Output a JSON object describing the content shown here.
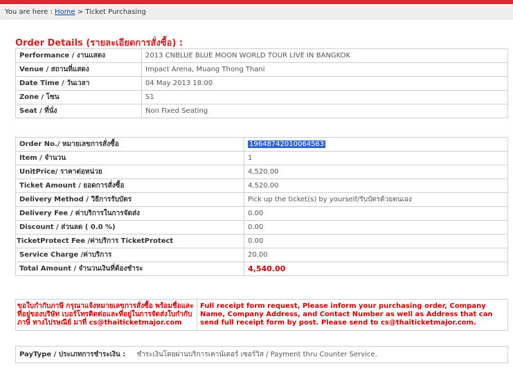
{
  "breadcrumb": {
    "prefix": "You are here :",
    "home": "Home",
    "separator": ">",
    "current": "Ticket Purchasing"
  },
  "order_details": {
    "title": "Order Details (รายละเอียดการสั่งซื้อ) :",
    "rows": [
      {
        "label": "Performance / งานแสดง",
        "value": "2013 CNBLUE BLUE MOON WORLD TOUR LIVE IN BANGKOK"
      },
      {
        "label": "Venue / สถานที่แสดง",
        "value": "Impact Arena, Muang Thong Thani"
      },
      {
        "label": "Date Time / วันเวลา",
        "value": "04 May 2013 18:00"
      },
      {
        "label": "Zone / โซน",
        "value": "S1"
      },
      {
        "label": "Seat / ที่นั่ง",
        "value": "Non Fixed Seating"
      }
    ]
  },
  "order_summary": {
    "rows": [
      {
        "label": "Order No./ หมายเลขการสั่งซื้อ",
        "value": "19648742010064563"
      },
      {
        "label": "Item / จำนวน",
        "value": "1"
      },
      {
        "label": "UnitPrice/ ราคาต่อหน่วย",
        "value": "4,520.00"
      },
      {
        "label": "Ticket Amount / ยอดการสั่งซื้อ",
        "value": "4,520.00"
      },
      {
        "label": "Delivery Method / วิธีการรับบัตร",
        "value": "Pick up the ticket(s) by yourself/รับบัตรด้วยตนเอง"
      },
      {
        "label": "Delivery Fee / ค่าบริการในการจัดส่ง",
        "value": "0.00"
      },
      {
        "label": "Discount / ส่วนลด ( 0.0 %)",
        "value": "0.00"
      },
      {
        "label": "TicketProtect Fee /ค่าบริการ TicketProtect",
        "value": "0.00"
      },
      {
        "label": "Service Charge /ค่าบริการ",
        "value": "20.00"
      },
      {
        "label": "Total Amount / จำนวนเงินที่ต้องชำระ",
        "value": "4,540.00"
      }
    ]
  },
  "receipt_note": {
    "thai": "ขอใบกำกับภาษี กรุณาแจ้งหมายเลขการสั่งซื้อ พร้อมชื่อและที่อยู่ของบริษัท เบอร์โทรติดต่อและที่อยู่ในการจัดส่งใบกำกับภาษี ทางไปรษณีย์ มาที่ cs@thaiticketmajor.com",
    "english": "Full receipt form request, Please inform your purchasing order, Company Name, Company Address, and Contact Number as well as Address that can send full receipt form by post. Please send to cs@thaiticketmajor.com."
  },
  "paytype": {
    "label": "PayType / ประเภทการชำระเงิน :",
    "value": "ชำระเงินโดยผ่านบริการเคาน์เตอร์ เซอร์วิส / Payment thru Counter Service."
  },
  "colors": {
    "brand_red": "#d7282f",
    "highlight": "#3366cc"
  }
}
